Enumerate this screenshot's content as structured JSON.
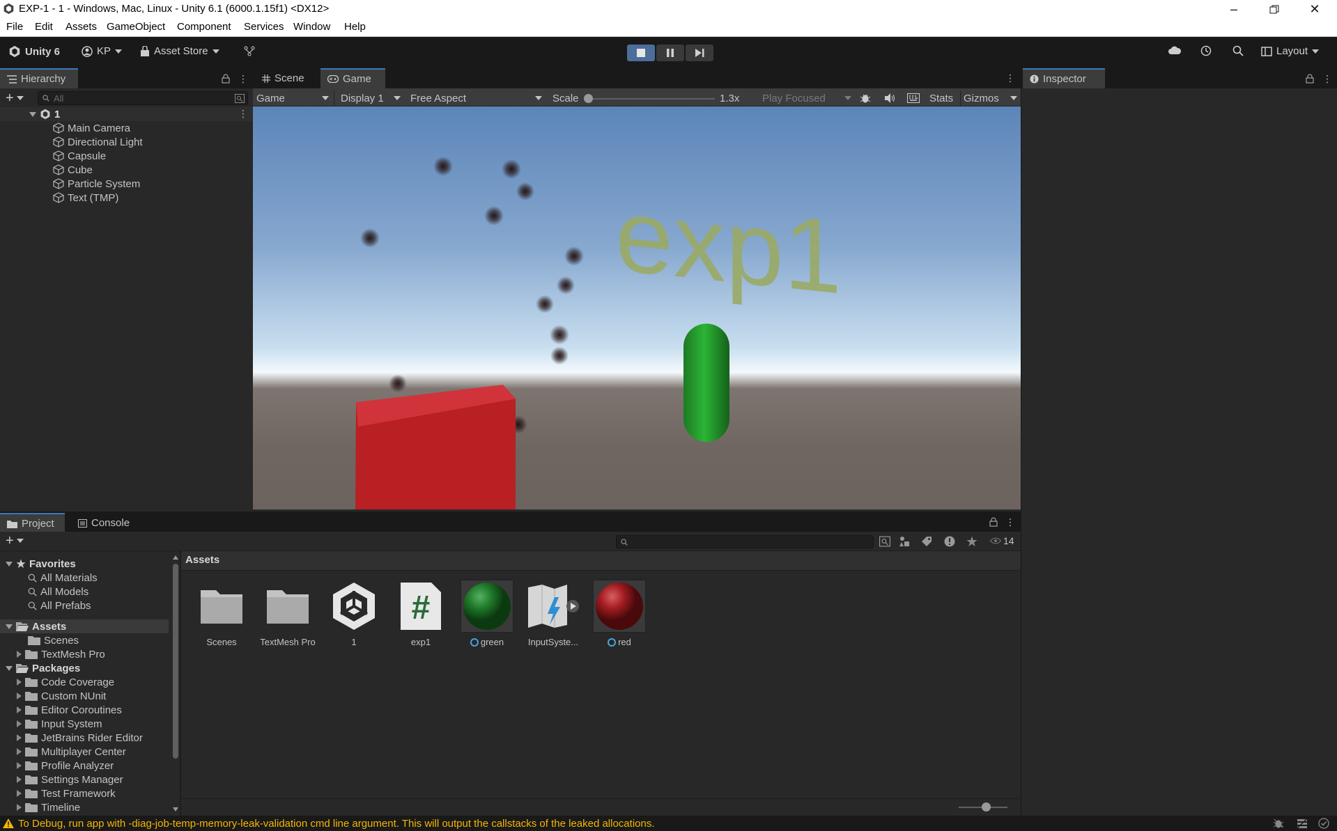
{
  "window": {
    "title": "EXP-1 - 1 - Windows, Mac, Linux - Unity 6.1 (6000.1.15f1) <DX12>"
  },
  "menu": [
    "File",
    "Edit",
    "Assets",
    "GameObject",
    "Component",
    "Services",
    "Window",
    "Help"
  ],
  "toolbar": {
    "unity_label": "Unity 6",
    "account_label": "KP",
    "asset_store_label": "Asset Store",
    "layout_label": "Layout"
  },
  "hierarchy": {
    "tab_label": "Hierarchy",
    "search_placeholder": "All",
    "scene_name": "1",
    "items": [
      "Main Camera",
      "Directional Light",
      "Capsule",
      "Cube",
      "Particle System",
      "Text (TMP)"
    ]
  },
  "game_view": {
    "tabs": [
      "Scene",
      "Game"
    ],
    "mode_dropdown": "Game",
    "display_dropdown": "Display 1",
    "aspect_dropdown": "Free Aspect",
    "scale_label": "Scale",
    "scale_value": "1.3x",
    "play_focused": "Play Focused",
    "stats_label": "Stats",
    "gizmos_label": "Gizmos",
    "scene_text": "exp1",
    "colors": {
      "sky_top": "#5f87b8",
      "ground": "#706660",
      "cube": "#c2262a",
      "capsule": "#22a02c",
      "text": "#9aa86a"
    }
  },
  "inspector": {
    "tab_label": "Inspector"
  },
  "project": {
    "tabs": [
      "Project",
      "Console"
    ],
    "hidden_count": "14",
    "favorites_label": "Favorites",
    "favorites": [
      "All Materials",
      "All Models",
      "All Prefabs"
    ],
    "assets_label": "Assets",
    "assets_children": [
      "Scenes",
      "TextMesh Pro"
    ],
    "packages_label": "Packages",
    "packages": [
      "Code Coverage",
      "Custom NUnit",
      "Editor Coroutines",
      "Input System",
      "JetBrains Rider Editor",
      "Multiplayer Center",
      "Profile Analyzer",
      "Settings Manager",
      "Test Framework",
      "Timeline"
    ],
    "breadcrumb": "Assets",
    "grid_items": [
      "Scenes",
      "TextMesh Pro",
      "1",
      "exp1",
      "green",
      "InputSyste...",
      "red"
    ]
  },
  "status": {
    "message": "To Debug, run app with -diag-job-temp-memory-leak-validation cmd line argument. This will output the callstacks of the leaked allocations."
  }
}
